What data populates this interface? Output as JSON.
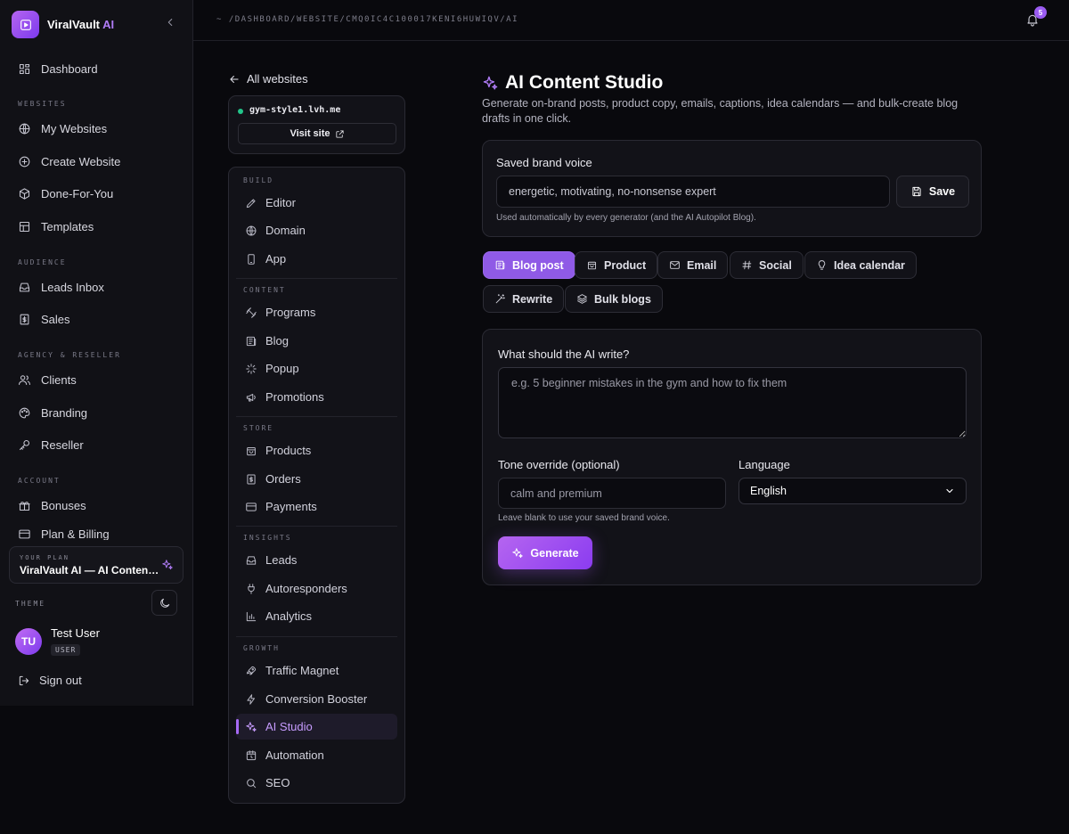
{
  "brand": {
    "name": "ViralVault",
    "accent": "AI"
  },
  "sidebar": {
    "items": {
      "dashboard": "Dashboard",
      "my_websites": "My Websites",
      "create_website": "Create Website",
      "done_for_you": "Done-For-You",
      "templates": "Templates",
      "leads_inbox": "Leads Inbox",
      "sales": "Sales",
      "clients": "Clients",
      "branding": "Branding",
      "reseller": "Reseller",
      "bonuses": "Bonuses",
      "plan_billing": "Plan & Billing"
    },
    "sections": {
      "websites": "WEBSITES",
      "audience": "AUDIENCE",
      "agency": "AGENCY & RESELLER",
      "account": "ACCOUNT"
    },
    "plan": {
      "label": "YOUR PLAN",
      "name": "ViralVault AI — AI Content Studio"
    },
    "theme_label": "THEME",
    "user": {
      "initials": "TU",
      "name": "Test User",
      "role": "USER"
    },
    "sign_out": "Sign out"
  },
  "topbar": {
    "breadcrumb": "~ /DASHBOARD/WEBSITE/CMQ0IC4C100017KENI6HUWIQV/AI",
    "notification_count": "5"
  },
  "site_panel": {
    "back_label": "All websites",
    "domain": "gym-style1.lvh.me",
    "visit_label": "Visit site",
    "sections": {
      "build": "BUILD",
      "content": "CONTENT",
      "store": "STORE",
      "insights": "INSIGHTS",
      "growth": "GROWTH"
    },
    "items": {
      "editor": "Editor",
      "domain": "Domain",
      "app": "App",
      "programs": "Programs",
      "blog": "Blog",
      "popup": "Popup",
      "promotions": "Promotions",
      "products": "Products",
      "orders": "Orders",
      "payments": "Payments",
      "leads": "Leads",
      "autoresponders": "Autoresponders",
      "analytics": "Analytics",
      "traffic_magnet": "Traffic Magnet",
      "conversion_booster": "Conversion Booster",
      "ai_studio": "AI Studio",
      "automation": "Automation",
      "seo": "SEO"
    }
  },
  "main": {
    "title": "AI Content Studio",
    "subtitle": "Generate on-brand posts, product copy, emails, captions, idea calendars — and bulk-create blog drafts in one click.",
    "brand_voice": {
      "label": "Saved brand voice",
      "value": "energetic, motivating, no-nonsense expert",
      "save_label": "Save",
      "hint": "Used automatically by every generator (and the AI Autopilot Blog)."
    },
    "tabs": {
      "blog_post": "Blog post",
      "product": "Product",
      "email": "Email",
      "social": "Social",
      "idea_calendar": "Idea calendar",
      "rewrite": "Rewrite",
      "bulk_blogs": "Bulk blogs"
    },
    "generator": {
      "prompt_label": "What should the AI write?",
      "prompt_placeholder": "e.g. 5 beginner mistakes in the gym and how to fix them",
      "tone_label": "Tone override (optional)",
      "tone_placeholder": "calm and premium",
      "tone_hint": "Leave blank to use your saved brand voice.",
      "language_label": "Language",
      "language_value": "English",
      "generate_label": "Generate"
    }
  },
  "colors": {
    "accent": "#9b5cf2",
    "background": "#09090d",
    "panel": "#121218",
    "status_online": "#22c58a"
  }
}
